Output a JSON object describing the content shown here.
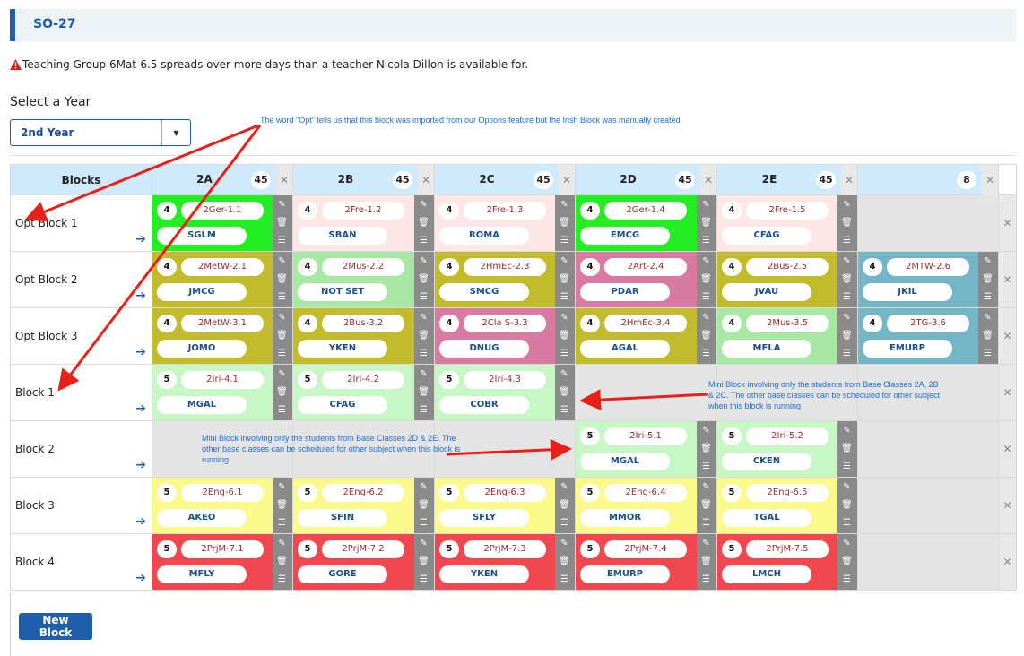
{
  "header": {
    "title": "SO-27"
  },
  "warning": {
    "text": "Teaching Group 6Mat-6.5 spreads over more days than a teacher Nicola Dillon is available for."
  },
  "year_select": {
    "label": "Select a Year",
    "value": "2nd Year"
  },
  "grid": {
    "blocks_header": "Blocks",
    "columns": [
      {
        "name": "2A",
        "count": "45"
      },
      {
        "name": "2B",
        "count": "45"
      },
      {
        "name": "2C",
        "count": "45"
      },
      {
        "name": "2D",
        "count": "45"
      },
      {
        "name": "2E",
        "count": "45"
      },
      {
        "name": "",
        "count": "8"
      }
    ],
    "rows": [
      {
        "name": "Opt Block 1",
        "cells": [
          {
            "num": "4",
            "code": "2Ger-1.1",
            "teacher": "SGLM",
            "color": "#22ee22"
          },
          {
            "num": "4",
            "code": "2Fre-1.2",
            "teacher": "SBAN",
            "color": "#fde6e6"
          },
          {
            "num": "4",
            "code": "2Fre-1.3",
            "teacher": "ROMA",
            "color": "#fde6e6"
          },
          {
            "num": "4",
            "code": "2Ger-1.4",
            "teacher": "EMCG",
            "color": "#22ee22"
          },
          {
            "num": "4",
            "code": "2Fre-1.5",
            "teacher": "CFAG",
            "color": "#fde6e6"
          },
          null
        ]
      },
      {
        "name": "Opt Block 2",
        "cells": [
          {
            "num": "4",
            "code": "2MetW-2.1",
            "teacher": "JMCG",
            "color": "#c2bb2c"
          },
          {
            "num": "4",
            "code": "2Mus-2.2",
            "teacher": "NOT SET",
            "color": "#a6e8a4"
          },
          {
            "num": "4",
            "code": "2HmEc-2.3",
            "teacher": "SMCG",
            "color": "#c2bb2c"
          },
          {
            "num": "4",
            "code": "2Art-2.4",
            "teacher": "PDAR",
            "color": "#d87aa2"
          },
          {
            "num": "4",
            "code": "2Bus-2.5",
            "teacher": "JVAU",
            "color": "#c2bb2c"
          },
          {
            "num": "4",
            "code": "2MTW-2.6",
            "teacher": "JKIL",
            "color": "#75b6c6"
          }
        ]
      },
      {
        "name": "Opt Block 3",
        "cells": [
          {
            "num": "4",
            "code": "2MetW-3.1",
            "teacher": "JOMO",
            "color": "#c2bb2c"
          },
          {
            "num": "4",
            "code": "2Bus-3.2",
            "teacher": "YKEN",
            "color": "#c2bb2c"
          },
          {
            "num": "4",
            "code": "2Cla S-3.3",
            "teacher": "DNUG",
            "color": "#d87aa2"
          },
          {
            "num": "4",
            "code": "2HmEc-3.4",
            "teacher": "AGAL",
            "color": "#c2bb2c"
          },
          {
            "num": "4",
            "code": "2Mus-3.5",
            "teacher": "MFLA",
            "color": "#a6e8a4"
          },
          {
            "num": "4",
            "code": "2TG-3.6",
            "teacher": "EMURP",
            "color": "#75b6c6"
          }
        ]
      },
      {
        "name": "Block 1",
        "cells": [
          {
            "num": "5",
            "code": "2Iri-4.1",
            "teacher": "MGAL",
            "color": "#c8f7c6"
          },
          {
            "num": "5",
            "code": "2Iri-4.2",
            "teacher": "CFAG",
            "color": "#c8f7c6"
          },
          {
            "num": "5",
            "code": "2Iri-4.3",
            "teacher": "COBR",
            "color": "#c8f7c6"
          },
          null,
          null,
          null
        ]
      },
      {
        "name": "Block 2",
        "cells": [
          null,
          null,
          null,
          {
            "num": "5",
            "code": "2Iri-5.1",
            "teacher": "MGAL",
            "color": "#c8f7c6"
          },
          {
            "num": "5",
            "code": "2Iri-5.2",
            "teacher": "CKEN",
            "color": "#c8f7c6"
          },
          null
        ]
      },
      {
        "name": "Block 3",
        "cells": [
          {
            "num": "5",
            "code": "2Eng-6.1",
            "teacher": "AKEO",
            "color": "#fbf98a"
          },
          {
            "num": "5",
            "code": "2Eng-6.2",
            "teacher": "SFIN",
            "color": "#fbf98a"
          },
          {
            "num": "5",
            "code": "2Eng-6.3",
            "teacher": "SFLY",
            "color": "#fbf98a"
          },
          {
            "num": "5",
            "code": "2Eng-6.4",
            "teacher": "MMOR",
            "color": "#fbf98a"
          },
          {
            "num": "5",
            "code": "2Eng-6.5",
            "teacher": "TGAL",
            "color": "#fbf98a"
          },
          null
        ]
      },
      {
        "name": "Block 4",
        "cells": [
          {
            "num": "5",
            "code": "2PrjM-7.1",
            "teacher": "MFLY",
            "color": "#f0484e"
          },
          {
            "num": "5",
            "code": "2PrjM-7.2",
            "teacher": "GORE",
            "color": "#f0484e"
          },
          {
            "num": "5",
            "code": "2PrjM-7.3",
            "teacher": "YKEN",
            "color": "#f0484e"
          },
          {
            "num": "5",
            "code": "2PrjM-7.4",
            "teacher": "EMURP",
            "color": "#f0484e"
          },
          {
            "num": "5",
            "code": "2PrjM-7.5",
            "teacher": "LMCH",
            "color": "#f0484e"
          },
          null
        ]
      }
    ]
  },
  "annotations": {
    "opt_note": "The word \"Opt\" tells us that this block was imported from our Options feature but the Irish Block was manually created",
    "mini_block_1": "Mini Block involving only the students from Base Classes 2A, 2B & 2C. The other base classes can be scheduled for other subject when this block is running",
    "mini_block_2": "Mini Block involving only the students from Base Classes 2D & 2E. The other base classes can be scheduled for other subject when this block is running"
  },
  "new_block_label": "New Block",
  "icons": {
    "edit": "pencil-icon",
    "delete": "trash-icon",
    "details": "list-icon",
    "move": "arrow-right-icon",
    "remove": "close-icon",
    "warning": "warning-triangle-icon",
    "dropdown": "chevron-down-icon"
  },
  "colors": {
    "accent": "#1f5ea8",
    "annotation": "#1a6fd6",
    "arrow": "#e8201a"
  }
}
